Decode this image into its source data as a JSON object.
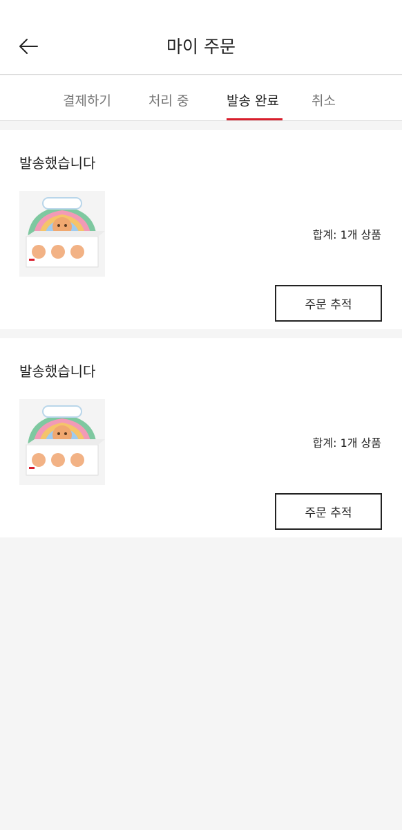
{
  "header": {
    "back_icon": "arrow-left-icon",
    "title": "마이 주문"
  },
  "tabs": [
    {
      "label": "결제하기",
      "active": false
    },
    {
      "label": "처리 중",
      "active": false
    },
    {
      "label": "발송 완료",
      "active": true
    },
    {
      "label": "취소",
      "active": false
    }
  ],
  "colors": {
    "accent": "#d81e2c",
    "page_background": "#f5f5f5"
  },
  "orders": [
    {
      "status": "발송했습니다",
      "summary": "합계: 1개 상품",
      "track_label": "주문 추적"
    },
    {
      "status": "발송했습니다",
      "summary": "합계: 1개 상품",
      "track_label": "주문 추적"
    }
  ]
}
